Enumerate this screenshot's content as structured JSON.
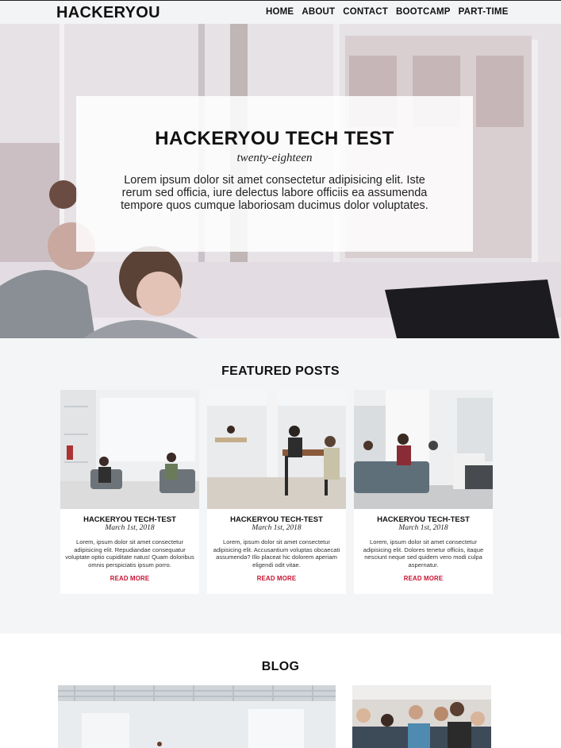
{
  "nav": {
    "logo": "HACKERYOU",
    "items": [
      "HOME",
      "ABOUT",
      "CONTACT",
      "BOOTCAMP",
      "PART-TIME"
    ]
  },
  "hero": {
    "title": "HACKERYOU TECH TEST",
    "subtitle": "twenty-eighteen",
    "text": "Lorem ipsum dolor sit amet consectetur adipisicing elit. Iste rerum sed officia, iure delectus labore officiis ea assumenda tempore quos cumque laboriosam ducimus dolor voluptates."
  },
  "featured": {
    "title": "FEATURED POSTS",
    "posts": [
      {
        "title": "HACKERYOU TECH-TEST",
        "date": "March 1st, 2018",
        "text": "Lorem, ipsum dolor sit amet consectetur adipisicing elit. Repudiandae consequatur voluptate optio cupiditate natus! Quam doloribus omnis perspiciatis ipsum porro.",
        "link": "READ MORE"
      },
      {
        "title": "HACKERYOU TECH-TEST",
        "date": "March 1st, 2018",
        "text": "Lorem, ipsum dolor sit amet consectetur adipisicing elit. Accusantium voluptas obcaecati assumenda? Illo placeat hic dolorem aperiam eligendi odit vitae.",
        "link": "READ MORE"
      },
      {
        "title": "HACKERYOU TECH-TEST",
        "date": "March 1st, 2018",
        "text": "Lorem, ipsum dolor sit amet consectetur adipisicing elit. Dolores tenetur officiis, itaque nesciunt neque sed quidem vero modi culpa aspernatur.",
        "link": "READ MORE"
      }
    ]
  },
  "blog": {
    "title": "BLOG"
  },
  "colors": {
    "accent": "#c8102e",
    "section_bg": "#f4f5f7"
  }
}
